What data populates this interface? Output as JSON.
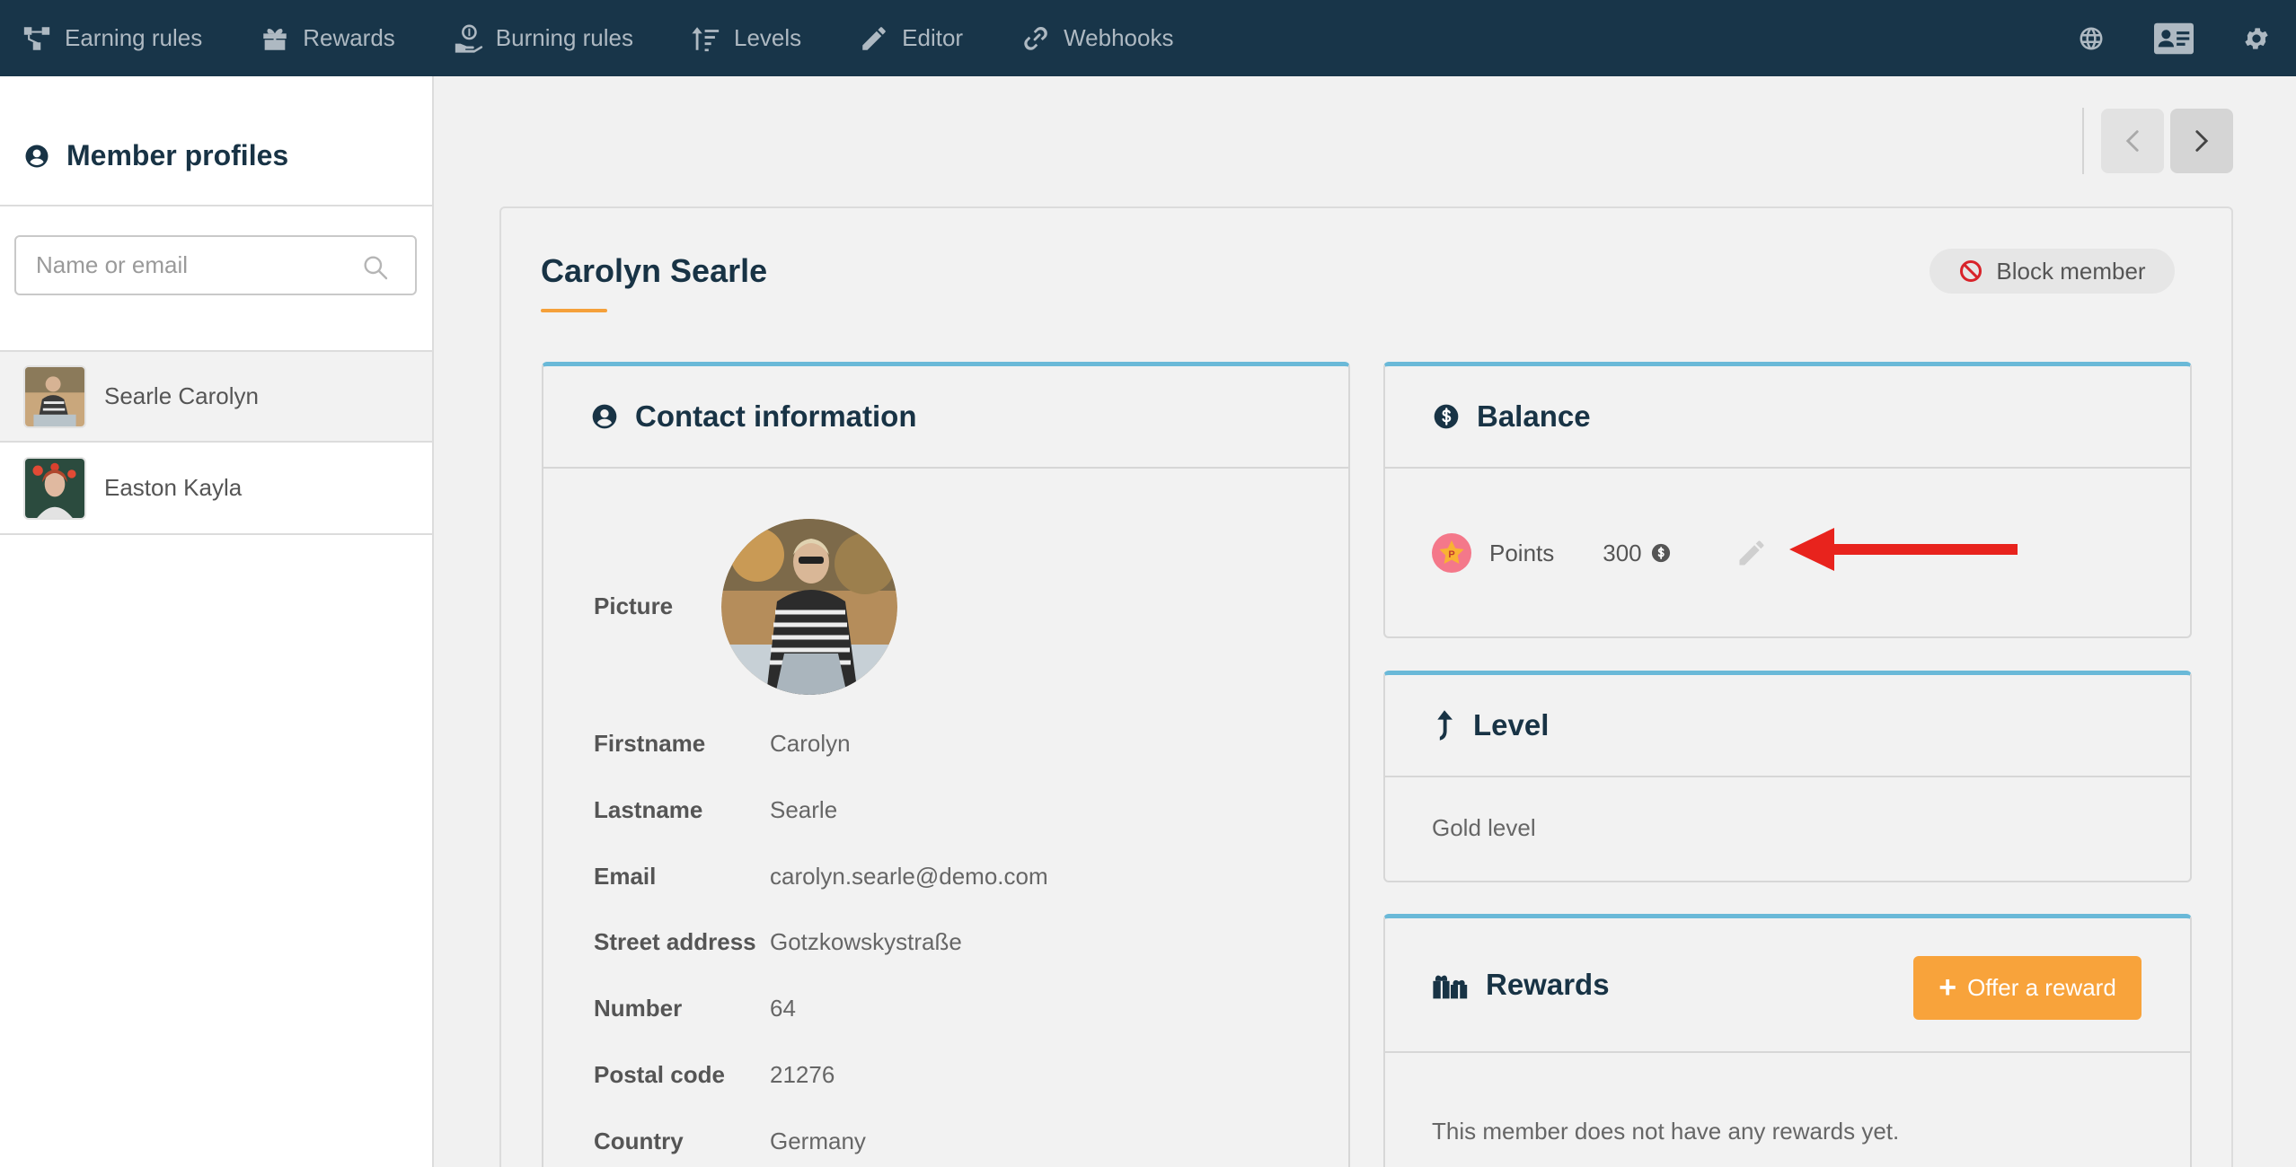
{
  "nav": {
    "items": [
      {
        "label": "Earning rules",
        "icon": "earning-rules-icon"
      },
      {
        "label": "Rewards",
        "icon": "gift-icon"
      },
      {
        "label": "Burning rules",
        "icon": "burning-rules-icon"
      },
      {
        "label": "Levels",
        "icon": "levels-icon"
      },
      {
        "label": "Editor",
        "icon": "pencil-icon"
      },
      {
        "label": "Webhooks",
        "icon": "link-icon"
      }
    ],
    "right_icons": [
      "globe-icon",
      "contact-card-icon",
      "gear-icon"
    ]
  },
  "sidebar": {
    "title": "Member profiles",
    "search_placeholder": "Name or email",
    "members": [
      {
        "name": "Searle Carolyn",
        "active": true
      },
      {
        "name": "Easton Kayla",
        "active": false
      }
    ]
  },
  "profile": {
    "name": "Carolyn Searle",
    "block_label": "Block member"
  },
  "contact": {
    "title": "Contact information",
    "fields": [
      {
        "label": "Picture",
        "value": ""
      },
      {
        "label": "Firstname",
        "value": "Carolyn"
      },
      {
        "label": "Lastname",
        "value": "Searle"
      },
      {
        "label": "Email",
        "value": "carolyn.searle@demo.com"
      },
      {
        "label": "Street address",
        "value": "Gotzkowskystraße"
      },
      {
        "label": "Number",
        "value": "64"
      },
      {
        "label": "Postal code",
        "value": "21276"
      },
      {
        "label": "Country",
        "value": "Germany"
      }
    ]
  },
  "balance": {
    "title": "Balance",
    "points_label": "Points",
    "points_value": "300"
  },
  "level": {
    "title": "Level",
    "value": "Gold level"
  },
  "rewards": {
    "title": "Rewards",
    "offer_label": "Offer a reward",
    "empty_text": "This member does not have any rewards yet."
  },
  "colors": {
    "topbar": "#183549",
    "accent_blue": "#6ab9d8",
    "accent_orange": "#f8a33b",
    "arrow_red": "#e8231d"
  }
}
